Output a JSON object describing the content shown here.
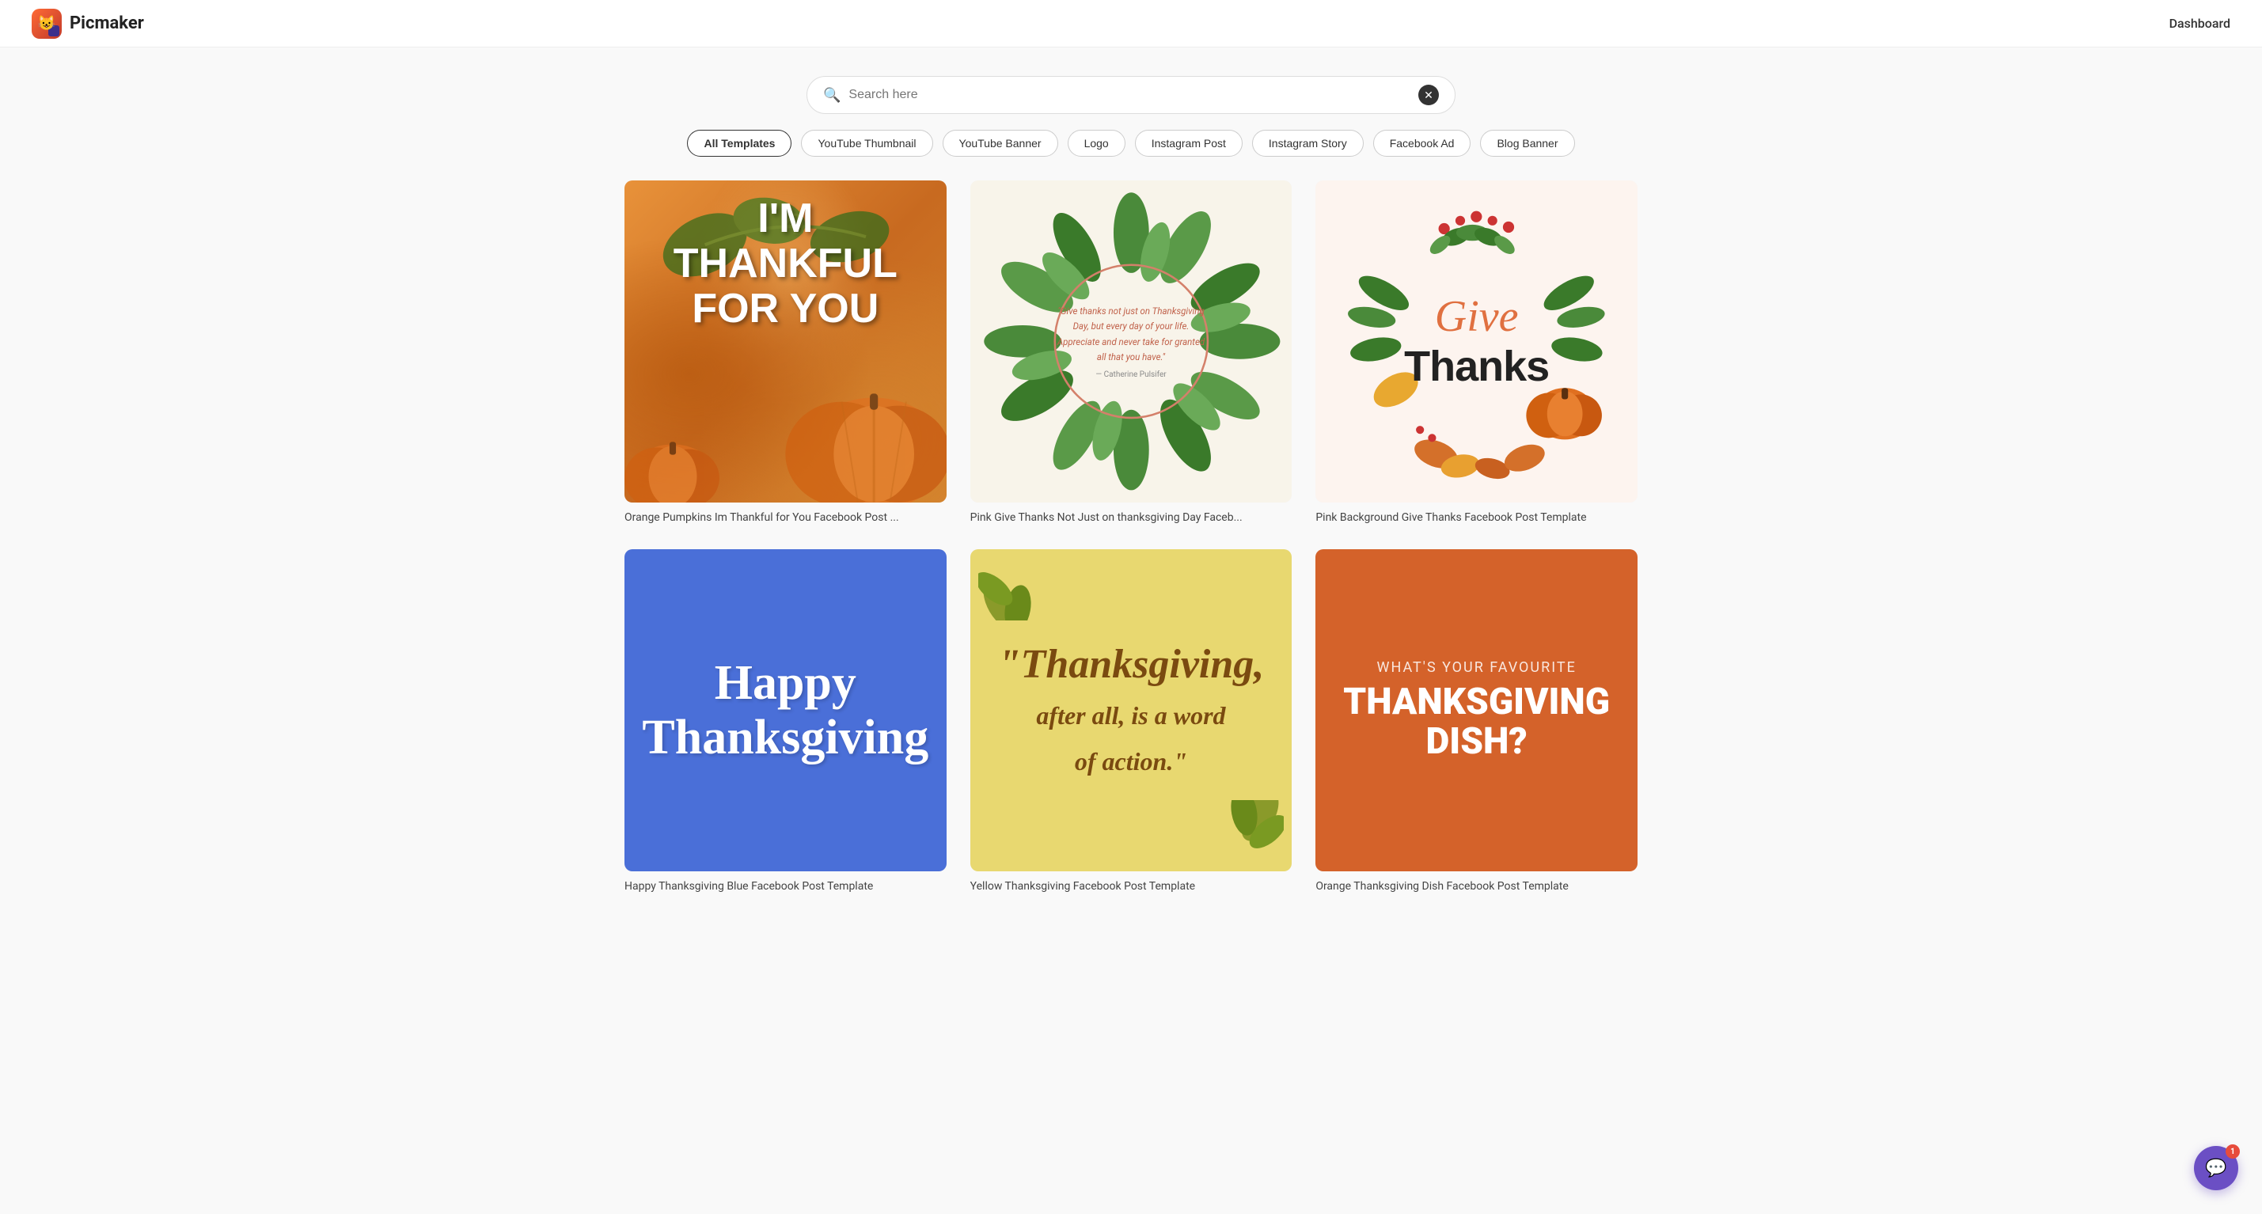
{
  "header": {
    "logo_text": "Picmaker",
    "dashboard_label": "Dashboard"
  },
  "search": {
    "placeholder": "Search here"
  },
  "filters": [
    {
      "id": "all",
      "label": "All Templates",
      "active": true
    },
    {
      "id": "youtube-thumbnail",
      "label": "YouTube Thumbnail",
      "active": false
    },
    {
      "id": "youtube-banner",
      "label": "YouTube Banner",
      "active": false
    },
    {
      "id": "logo",
      "label": "Logo",
      "active": false
    },
    {
      "id": "instagram-post",
      "label": "Instagram Post",
      "active": false
    },
    {
      "id": "instagram-story",
      "label": "Instagram Story",
      "active": false
    },
    {
      "id": "facebook-ad",
      "label": "Facebook Ad",
      "active": false
    },
    {
      "id": "blog-banner",
      "label": "Blog Banner",
      "active": false
    }
  ],
  "templates": [
    {
      "id": "card1",
      "label": "Orange Pumpkins Im Thankful for You Facebook Post ...",
      "main_text": "I'M THANKFUL FOR YOU",
      "type": "pumpkin"
    },
    {
      "id": "card2",
      "label": "Pink Give Thanks Not Just on thanksgiving Day Faceb...",
      "quote": "\"Give thanks not just on Thanksgiving Day, but every day of your life. Appreciate and never take for granted all that you have.\"",
      "attribution": "— Catherine Pulsifer",
      "type": "wreath"
    },
    {
      "id": "card3",
      "label": "Pink Background Give Thanks Facebook Post Template",
      "text_line1": "Give",
      "text_line2": "Thanks",
      "type": "give-thanks"
    },
    {
      "id": "card4",
      "label": "Happy Thanksgiving Blue Facebook Post Template",
      "main_text": "Happy\nThanksgiving",
      "type": "blue-thanksgiving"
    },
    {
      "id": "card5",
      "label": "Yellow Thanksgiving Facebook Post Template",
      "main_text": "\"Thanksgiving,\nafter all, is a word\nof action.\"",
      "type": "yellow-thanksgiving"
    },
    {
      "id": "card6",
      "label": "Orange Thanksgiving Dish Facebook Post Template",
      "text_top": "What's Your Favourite",
      "text_main": "Thanksgiving Dish?",
      "type": "orange-dish"
    }
  ],
  "chat": {
    "badge": "1"
  }
}
